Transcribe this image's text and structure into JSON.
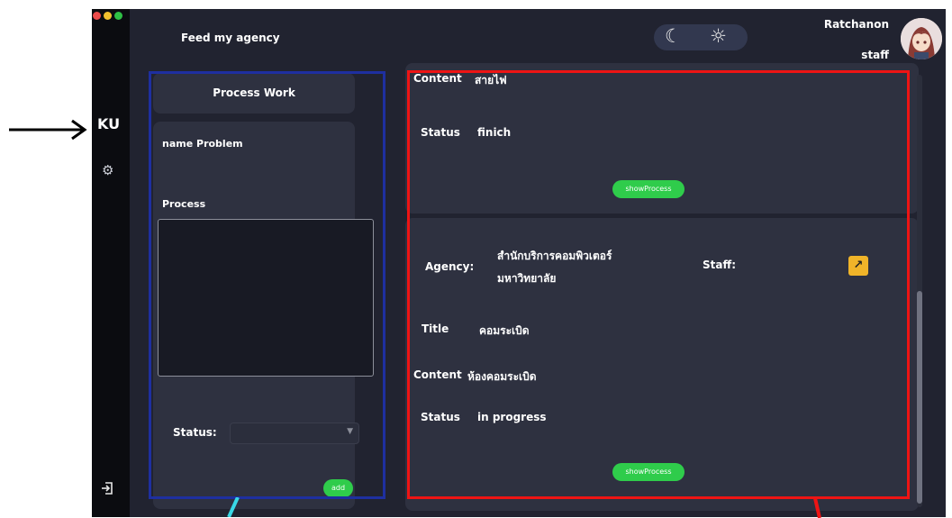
{
  "window": {
    "traffic_lights": [
      "#ec4b4b",
      "#f2c12e",
      "#2fc045"
    ]
  },
  "sidebar": {
    "brand": "KU",
    "settings_icon": "gear-icon",
    "logout_icon": "logout-icon"
  },
  "header": {
    "title": "Feed my agency",
    "theme_toggle": {
      "dark_icon": "moon-icon",
      "light_icon": "sun-icon"
    },
    "user": {
      "name": "Ratchanon",
      "role": "staff"
    }
  },
  "left_panel": {
    "process_work_button": "Process Work",
    "name_problem_label": "name Problem",
    "process_label": "Process",
    "process_value": "",
    "status_label": "Status:",
    "status_value": "",
    "add_button": "add"
  },
  "right_panel": {
    "items": [
      {
        "content_label": "Content",
        "content_value": "สายไฟ",
        "status_label": "Status",
        "status_value": "finich",
        "show_button": "showProcess"
      },
      {
        "agency_label": "Agency:",
        "agency_line1": "สำนักบริการคอมพิวเตอร์",
        "agency_line2": "มหาวิทยาลัย",
        "staff_label": "Staff:",
        "open_icon": "arrow-up-right-icon",
        "title_label": "Title",
        "title_value": "คอมระเบิด",
        "content_label": "Content",
        "content_value": "ห้องคอมระเบิด",
        "status_label": "Status",
        "status_value": "in progress",
        "show_button": "showProcess"
      }
    ]
  },
  "colors": {
    "app_bg": "#212330",
    "card_bg": "#2e3140",
    "accent_green": "#2fcc4b",
    "accent_yellow": "#f0b429",
    "annotation_blue": "#1e2fa0",
    "annotation_red": "#ee1414",
    "annotation_cyan": "#39d8e6"
  }
}
